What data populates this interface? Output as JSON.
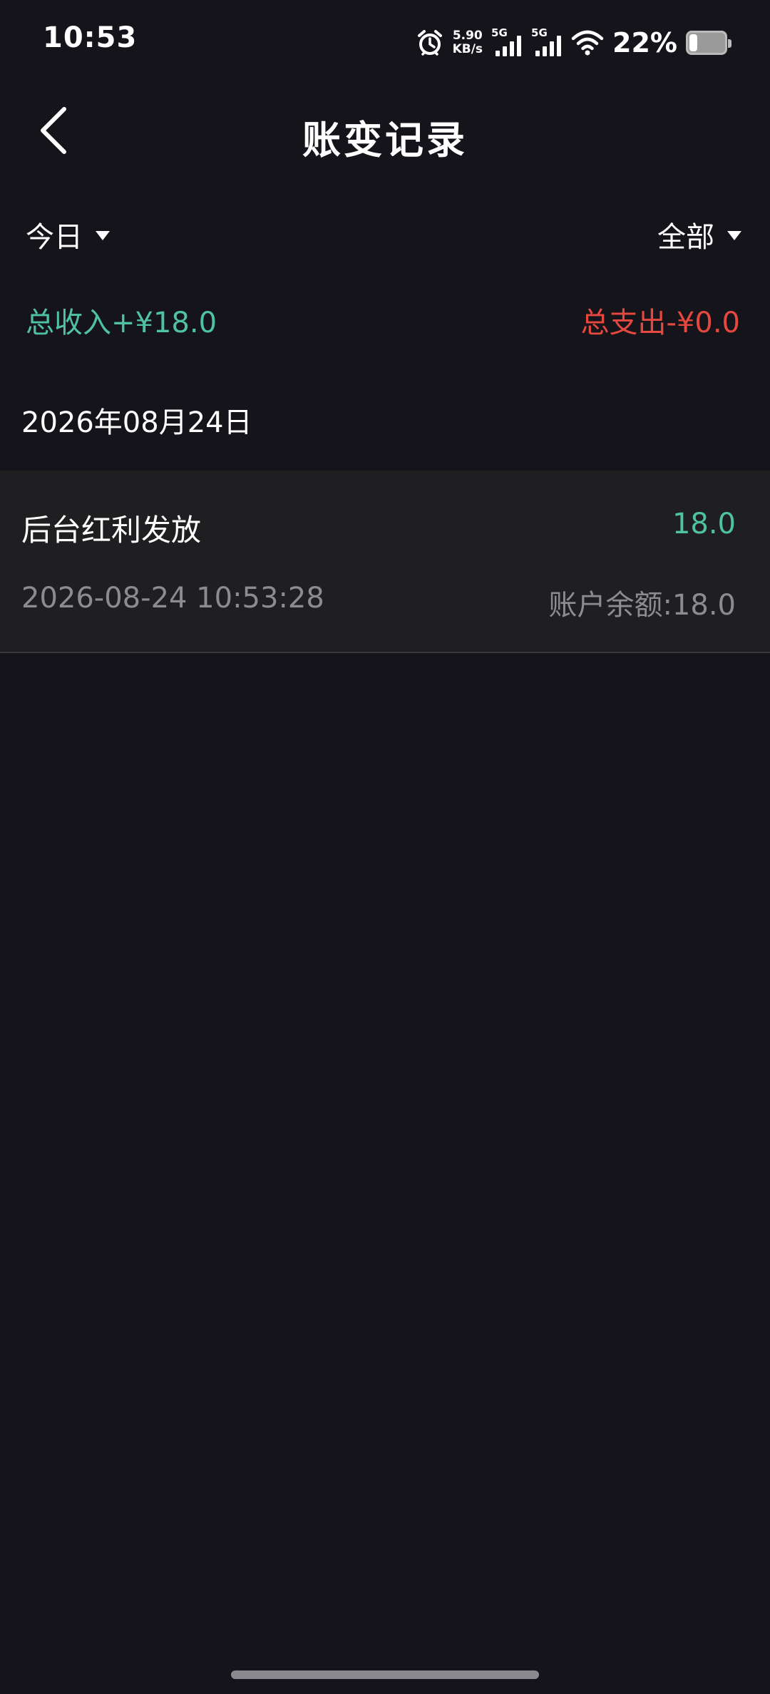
{
  "status_bar": {
    "time": "10:53",
    "net_speed_value": "5.90",
    "net_speed_unit": "KB/s",
    "sim1_label": "5G",
    "sim2_label": "5G",
    "battery_percent": "22%",
    "battery_level": 0.22,
    "icons": [
      "alarm-icon",
      "signal-icon",
      "wifi-icon",
      "battery-icon"
    ]
  },
  "header": {
    "title": "账变记录",
    "back_icon": "chevron-left-icon"
  },
  "filters": {
    "period": "今日",
    "category": "全部"
  },
  "totals": {
    "income": "总收入+¥18.0",
    "expense": "总支出-¥0.0"
  },
  "groups": [
    {
      "date": "2026年08月24日",
      "records": [
        {
          "title": "后台红利发放",
          "amount": "18.0",
          "time": "2026-08-24 10:53:28",
          "balance": "账户余额:18.0"
        }
      ]
    }
  ],
  "colors": {
    "background": "#15141a",
    "income": "#4fc3a1",
    "expense": "#e5483e",
    "secondary_text": "#8c8c90",
    "item_background": "#1f1f22"
  }
}
